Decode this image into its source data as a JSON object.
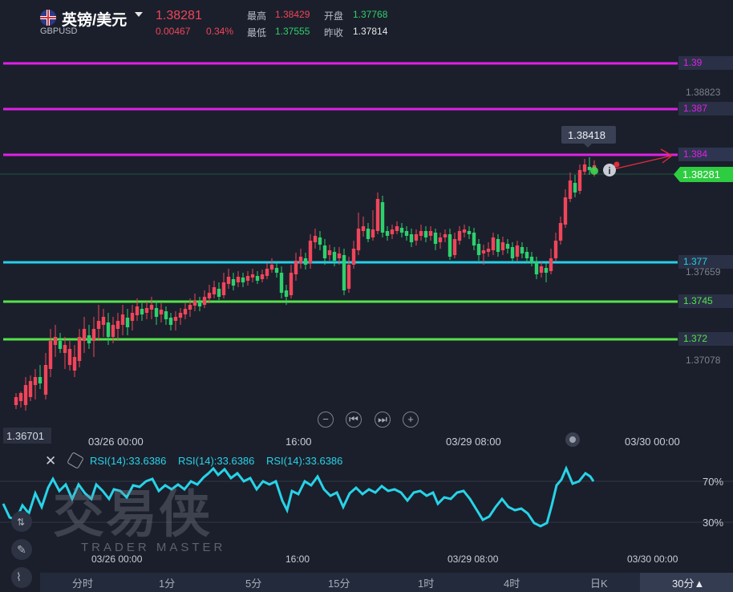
{
  "header": {
    "title": "英镑/美元",
    "symbol": "GBPUSD",
    "price": "1.38281",
    "change": "0.00467",
    "change_pct": "0.34%",
    "high_label": "最高",
    "high": "1.38429",
    "open_label": "开盘",
    "open": "1.37768",
    "low_label": "最低",
    "low": "1.37555",
    "prev_label": "昨收",
    "prev": "1.37814"
  },
  "price_axis": {
    "top_right_label": "1.38823",
    "mid_label": "1.37659",
    "low_label": "1.37078",
    "current": "1.38281",
    "min_marker": "1.36701",
    "max_marker": "1.38418"
  },
  "levels": [
    {
      "label": "1.39",
      "color": "#e020e8"
    },
    {
      "label": "1.387",
      "color": "#e020e8"
    },
    {
      "label": "1.384",
      "color": "#e020e8"
    },
    {
      "label": "1.377",
      "color": "#25cfe8"
    },
    {
      "label": "1.3745",
      "color": "#55e24a"
    },
    {
      "label": "1.372",
      "color": "#55e24a"
    }
  ],
  "time_axis": [
    "03/26 00:00",
    "16:00",
    "03/29 08:00",
    "03/30 00:00"
  ],
  "rsi": {
    "labels": [
      "RSI(14):33.6386",
      "RSI(14):33.6386",
      "RSI(14):33.6386"
    ],
    "level_high": "70%",
    "level_low": "30%"
  },
  "watermark": {
    "main": "交易侠",
    "sub": "TRADER MASTER"
  },
  "periods": [
    "分时",
    "1分",
    "5分",
    "15分",
    "1时",
    "4时",
    "日K",
    "30分▲"
  ],
  "icons": {
    "zoom_out": "minus-circle-icon",
    "prev": "skip-back-icon",
    "next": "skip-forward-icon",
    "zoom_in": "plus-circle-icon"
  },
  "colors": {
    "up": "#f0455a",
    "down": "#2ed06e",
    "rsi": "#27d3e8"
  }
}
